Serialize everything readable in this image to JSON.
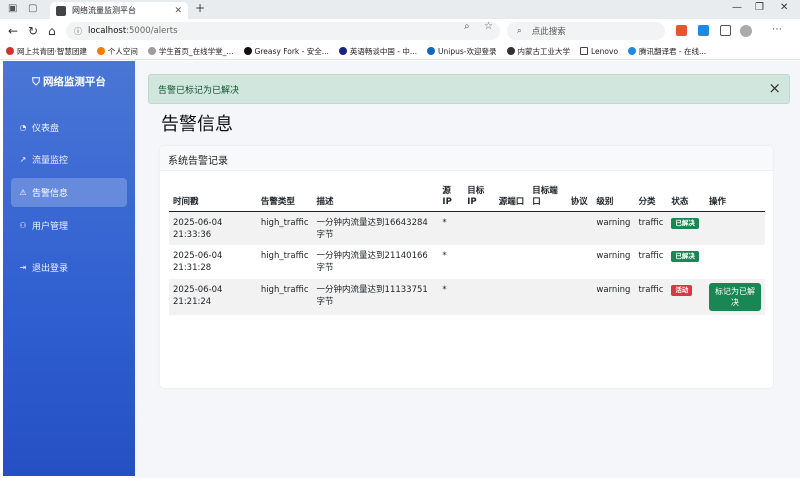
{
  "browser": {
    "tab_title": "网络流量监测平台",
    "url_host": "localhost",
    "url_path": ":5000/alerts",
    "search_placeholder": "点此搜索",
    "bookmarks": [
      "网上共青团·智慧团建",
      "个人空间",
      "学生首页_在线学堂_...",
      "Greasy Fork - 安全...",
      "英语畅谈中国 - 中...",
      "Unipus-欢迎登录",
      "内蒙古工业大学",
      "Lenovo",
      "腾讯翻译君 - 在线..."
    ]
  },
  "sidebar": {
    "brand": "网络监测平台",
    "items": [
      {
        "label": "仪表盘",
        "icon": "speedometer-icon"
      },
      {
        "label": "流量监控",
        "icon": "graph-icon"
      },
      {
        "label": "告警信息",
        "icon": "warning-icon"
      },
      {
        "label": "用户管理",
        "icon": "users-icon"
      },
      {
        "label": "退出登录",
        "icon": "logout-icon"
      }
    ],
    "active_index": 2
  },
  "main": {
    "flash_message": "告警已标记为已解决",
    "page_title": "告警信息",
    "card_title": "系统告警记录",
    "columns": [
      "时间戳",
      "告警类型",
      "描述",
      "源IP",
      "目标IP",
      "源端口",
      "目标端口",
      "协议",
      "级别",
      "分类",
      "状态",
      "操作"
    ],
    "rows": [
      {
        "timestamp": "2025-06-04 21:33:36",
        "type": "high_traffic",
        "description": "一分钟内流量达到16643284字节",
        "src_ip": "*",
        "dst_ip": "",
        "src_port": "",
        "dst_port": "",
        "protocol": "",
        "level": "warning",
        "category": "traffic",
        "status": "已解决",
        "status_color": "#198754",
        "action": ""
      },
      {
        "timestamp": "2025-06-04 21:31:28",
        "type": "high_traffic",
        "description": "一分钟内流量达到21140166字节",
        "src_ip": "*",
        "dst_ip": "",
        "src_port": "",
        "dst_port": "",
        "protocol": "",
        "level": "warning",
        "category": "traffic",
        "status": "已解决",
        "status_color": "#198754",
        "action": ""
      },
      {
        "timestamp": "2025-06-04 21:21:24",
        "type": "high_traffic",
        "description": "一分钟内流量达到11133751字节",
        "src_ip": "*",
        "dst_ip": "",
        "src_port": "",
        "dst_port": "",
        "protocol": "",
        "level": "warning",
        "category": "traffic",
        "status": "活动",
        "status_color": "#dc3545",
        "action": "标记为已解决"
      }
    ]
  },
  "colors": {
    "sidebar_top": "#4a76d6",
    "sidebar_bottom": "#2550c4",
    "success": "#198754",
    "danger": "#dc3545",
    "flash_bg": "#d1e7dd"
  }
}
